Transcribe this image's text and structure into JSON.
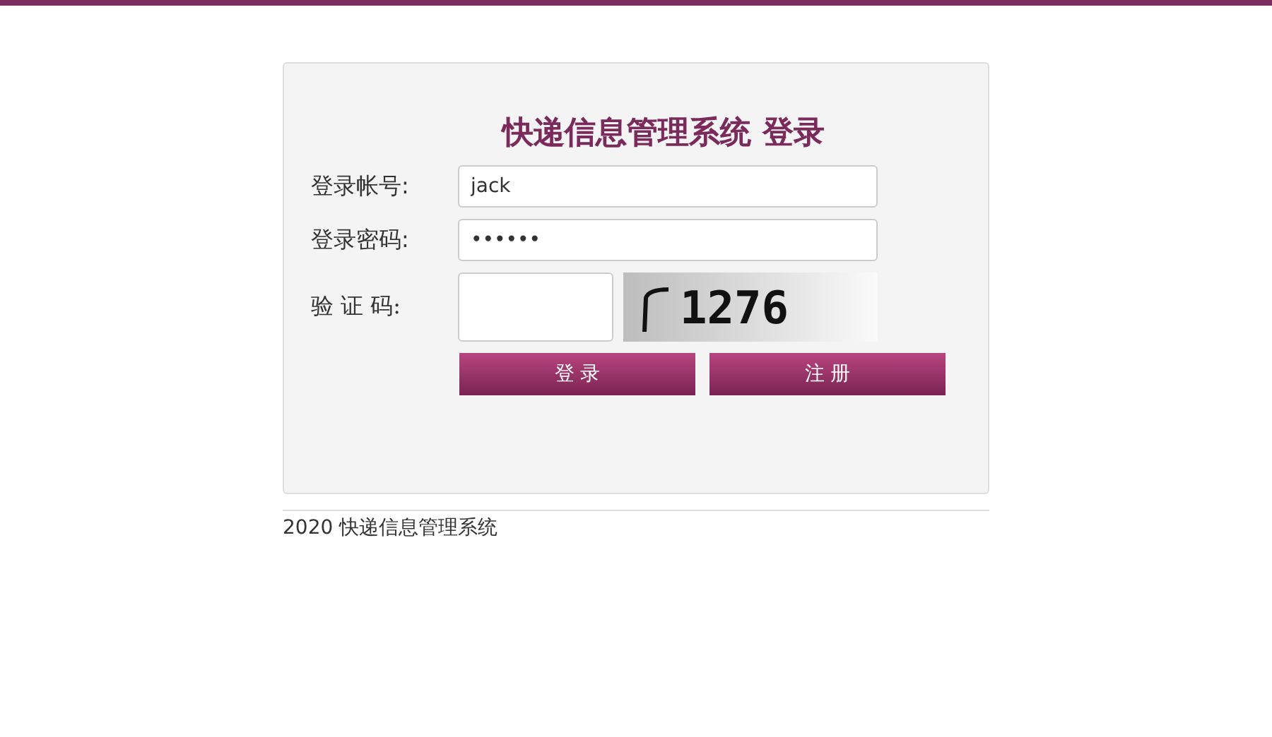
{
  "login": {
    "title": "快递信息管理系统 登录",
    "fields": [
      {
        "kind": "text",
        "label": "登录帐号:",
        "value": "jack"
      },
      {
        "kind": "text",
        "label": "登录密码:",
        "value": "••••••"
      },
      {
        "kind": "captcha",
        "label": "验 证 码:",
        "captcha": "1276"
      }
    ],
    "buttons": [
      "登 录",
      "注 册"
    ]
  },
  "footer": "2020 快递信息管理系统"
}
